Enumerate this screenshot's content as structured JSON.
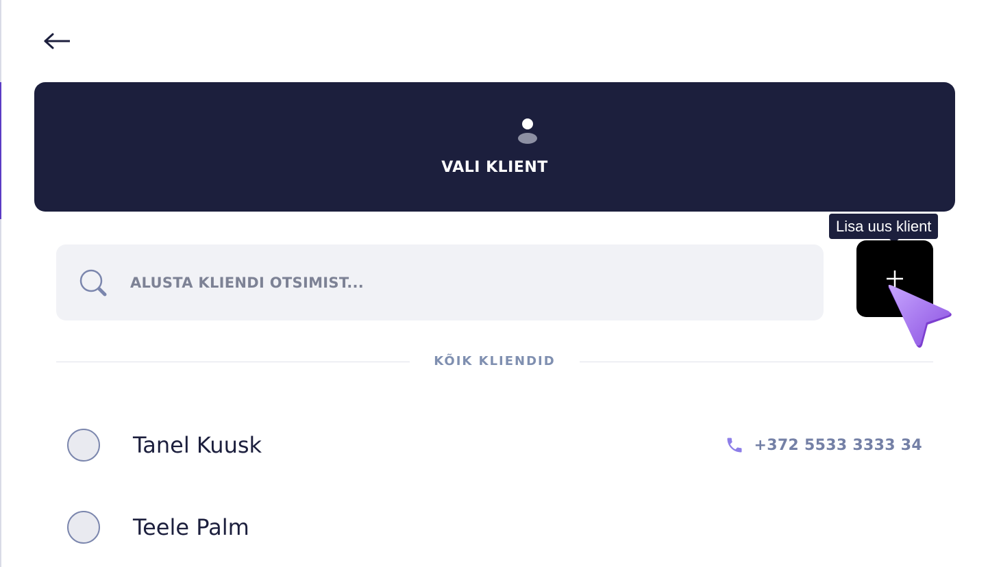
{
  "header": {
    "title": "VALI KLIENT",
    "icon": "user-icon"
  },
  "search": {
    "placeholder": "ALUSTA KLIENDI OTSIMIST...",
    "value": ""
  },
  "add_client": {
    "tooltip": "Lisa uus klient",
    "icon": "plus-icon"
  },
  "section": {
    "label": "KÕIK KLIENDID"
  },
  "clients": [
    {
      "name": "Tanel Kuusk",
      "phone": "+372 5533 3333 34",
      "selected": false
    },
    {
      "name": "Teele Palm",
      "phone": "",
      "selected": false
    }
  ],
  "colors": {
    "header_bg": "#1c1f3d",
    "accent": "#5b3cc4",
    "phone_icon": "#8d7ee8",
    "muted_text": "#7f8fb0",
    "search_bg": "#f1f2f6"
  }
}
